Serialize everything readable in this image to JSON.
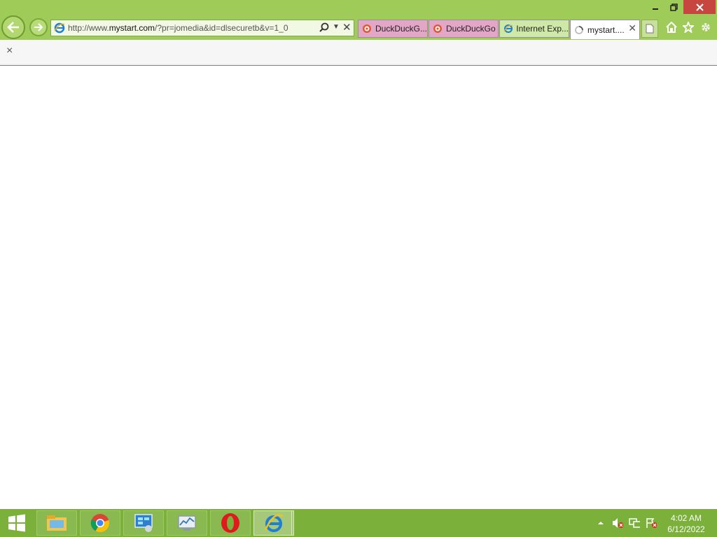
{
  "window": {
    "minimize_glyph": "–",
    "restore_glyph": "❐",
    "close_glyph": "✕"
  },
  "address_bar": {
    "url_prefix": "http://www.",
    "url_domain": "mystart.com",
    "url_suffix": "/?pr=jomedia&id=dlsecuretb&v=1_0"
  },
  "tabs": [
    {
      "label": "DuckDuckG...",
      "icon": "duckduckgo-icon"
    },
    {
      "label": "DuckDuckGo",
      "icon": "duckduckgo-icon"
    },
    {
      "label": "Internet Exp...",
      "icon": "internet-explorer-icon"
    },
    {
      "label": "mystart....",
      "icon": "loading-spinner-icon",
      "active": true
    }
  ],
  "notification_bar": {
    "close_glyph": "×"
  },
  "taskbar": {
    "pinned": [
      "file-explorer",
      "chrome",
      "control-panel",
      "resource-monitor",
      "opera",
      "internet-explorer"
    ],
    "clock_time": "4:02 AM",
    "clock_date": "6/12/2022"
  },
  "colors": {
    "chrome_bg": "#9fcb58",
    "taskbar_bg": "#7bb03a",
    "close_button": "#c7463f",
    "ddg_tab": "#e4a6c7"
  }
}
